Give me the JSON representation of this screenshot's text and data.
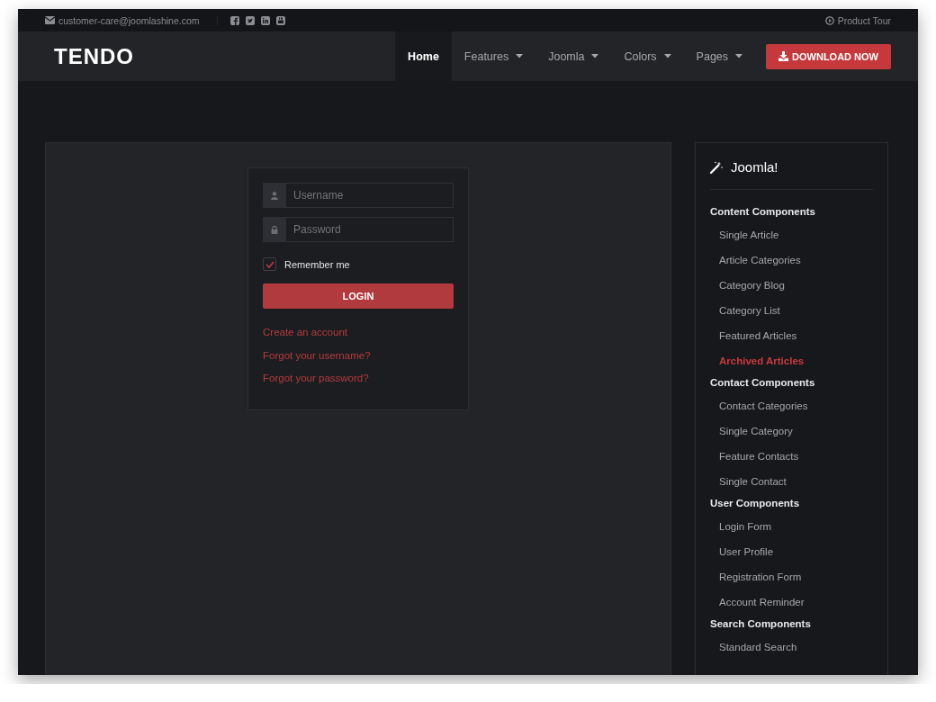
{
  "topbar": {
    "email": "customer-care@joomlashine.com",
    "social": [
      {
        "kind": "facebook"
      },
      {
        "kind": "twitter"
      },
      {
        "kind": "linkedin"
      },
      {
        "kind": "youtube"
      }
    ],
    "tour": "Product Tour"
  },
  "header": {
    "logo": "TENDO",
    "nav": [
      {
        "label": "Home",
        "selected": true,
        "dropdown": false
      },
      {
        "label": "Features",
        "selected": false,
        "dropdown": true
      },
      {
        "label": "Joomla",
        "selected": false,
        "dropdown": true
      },
      {
        "label": "Colors",
        "selected": false,
        "dropdown": true
      },
      {
        "label": "Pages",
        "selected": false,
        "dropdown": true
      }
    ],
    "download": "DOWNLOAD NOW"
  },
  "login": {
    "username": {
      "placeholder": "Username"
    },
    "password": {
      "placeholder": "Password"
    },
    "remember": {
      "label": "Remember me",
      "checked": true
    },
    "button": "LOGIN",
    "links": [
      "Create an account",
      "Forgot your username?",
      "Forgot your password?"
    ]
  },
  "sidebar": {
    "title": "Joomla!",
    "groups": [
      {
        "label": "Content Components",
        "children": [
          {
            "label": "Single Article",
            "selected": false
          },
          {
            "label": "Article Categories",
            "selected": false
          },
          {
            "label": "Category Blog",
            "selected": false
          },
          {
            "label": "Category List",
            "selected": false
          },
          {
            "label": "Featured Articles",
            "selected": false
          },
          {
            "label": "Archived Articles",
            "selected": true
          }
        ]
      },
      {
        "label": "Contact Components",
        "children": [
          {
            "label": "Contact Categories",
            "selected": false
          },
          {
            "label": "Single Category",
            "selected": false
          },
          {
            "label": "Feature Contacts",
            "selected": false
          },
          {
            "label": "Single Contact",
            "selected": false
          }
        ]
      },
      {
        "label": "User Components",
        "children": [
          {
            "label": "Login Form",
            "selected": false
          },
          {
            "label": "User Profile",
            "selected": false
          },
          {
            "label": "Registration Form",
            "selected": false
          },
          {
            "label": "Account Reminder",
            "selected": false
          }
        ]
      },
      {
        "label": "Search Components",
        "children": [
          {
            "label": "Standard Search",
            "selected": false
          }
        ]
      }
    ]
  }
}
